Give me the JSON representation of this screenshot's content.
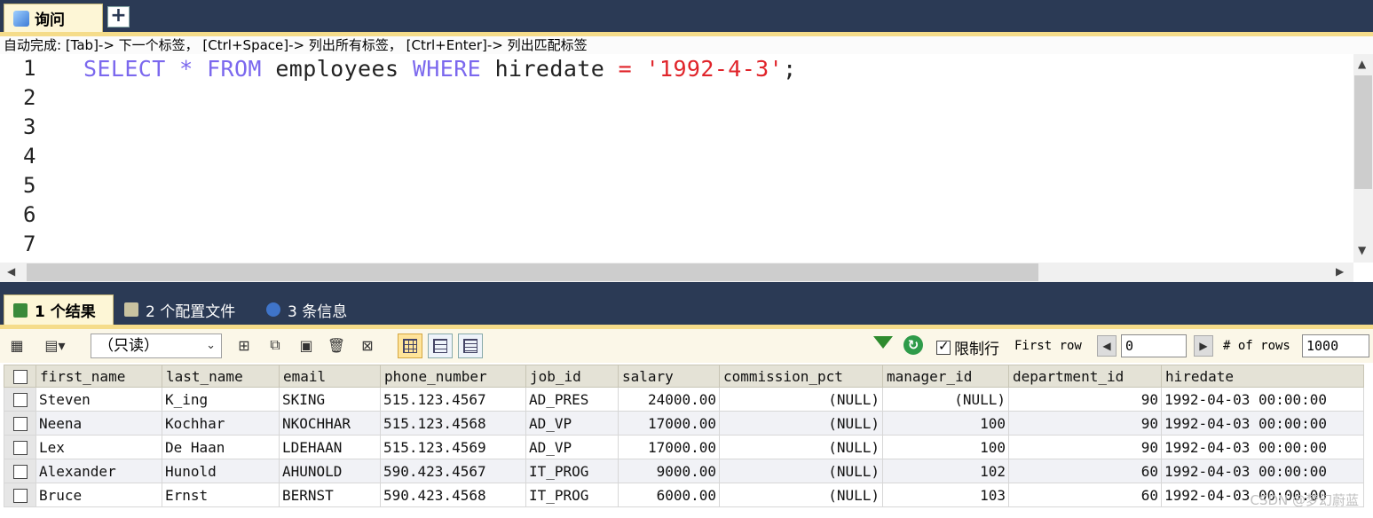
{
  "query_tab": {
    "label": "询问",
    "add_label": "+"
  },
  "hint": "自动完成:  [Tab]-> 下一个标签， [Ctrl+Space]-> 列出所有标签， [Ctrl+Enter]-> 列出匹配标签",
  "editor": {
    "line_numbers": [
      "1",
      "2",
      "3",
      "4",
      "5",
      "6",
      "7"
    ],
    "sql": {
      "select": "SELECT",
      "star": "*",
      "from": "FROM",
      "table": "employees",
      "where": "WHERE",
      "column": "hiredate",
      "eq": "=",
      "value": "'1992-4-3'",
      "semicolon": ";"
    }
  },
  "result_tabs": [
    {
      "label": "1 个结果",
      "active": true,
      "icon": "result-grid-icon"
    },
    {
      "label": "2 个配置文件",
      "active": false,
      "icon": "profile-icon"
    },
    {
      "label": "3 条信息",
      "active": false,
      "icon": "info-icon"
    }
  ],
  "toolbar": {
    "mode": "（只读）",
    "limit_label": "限制行",
    "limit_checked": true,
    "first_row_label": "First row",
    "first_row_value": "0",
    "num_rows_label": "# of rows",
    "num_rows_value": "1000"
  },
  "table": {
    "columns": [
      "first_name",
      "last_name",
      "email",
      "phone_number",
      "job_id",
      "salary",
      "commission_pct",
      "manager_id",
      "department_id",
      "hiredate"
    ],
    "rows": [
      [
        "Steven",
        "K_ing",
        "SKING",
        "515.123.4567",
        "AD_PRES",
        "24000.00",
        "(NULL)",
        "(NULL)",
        "90",
        "1992-04-03 00:00:00"
      ],
      [
        "Neena",
        "Kochhar",
        "NKOCHHAR",
        "515.123.4568",
        "AD_VP",
        "17000.00",
        "(NULL)",
        "100",
        "90",
        "1992-04-03 00:00:00"
      ],
      [
        "Lex",
        "De Haan",
        "LDEHAAN",
        "515.123.4569",
        "AD_VP",
        "17000.00",
        "(NULL)",
        "100",
        "90",
        "1992-04-03 00:00:00"
      ],
      [
        "Alexander",
        "Hunold",
        "AHUNOLD",
        "590.423.4567",
        "IT_PROG",
        "9000.00",
        "(NULL)",
        "102",
        "60",
        "1992-04-03 00:00:00"
      ],
      [
        "Bruce",
        "Ernst",
        "BERNST",
        "590.423.4568",
        "IT_PROG",
        "6000.00",
        "(NULL)",
        "103",
        "60",
        "1992-04-03 00:00:00"
      ]
    ]
  },
  "watermark": "CSDN @梦幻蔚蓝",
  "colors": {
    "keyword": "#7b68ee",
    "string": "#e0242a",
    "frame": "#2b3a55",
    "accent": "#f5dc8a"
  }
}
